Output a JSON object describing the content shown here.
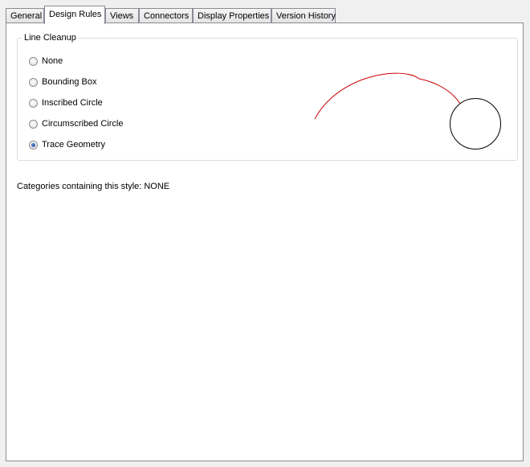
{
  "tabs": [
    {
      "label": "General"
    },
    {
      "label": "Design Rules"
    },
    {
      "label": "Views"
    },
    {
      "label": "Connectors"
    },
    {
      "label": "Display Properties"
    },
    {
      "label": "Version History"
    }
  ],
  "active_tab": "Design Rules",
  "line_cleanup": {
    "legend": "Line Cleanup",
    "options": [
      {
        "label": "None",
        "checked": false
      },
      {
        "label": "Bounding Box",
        "checked": false
      },
      {
        "label": "Inscribed Circle",
        "checked": false
      },
      {
        "label": "Circumscribed Circle",
        "checked": false
      },
      {
        "label": "Trace Geometry",
        "checked": true
      }
    ]
  },
  "categories_text": "Categories containing this style: NONE",
  "colors": {
    "preview_arc": "#cc0000",
    "preview_circle": "#000000"
  }
}
